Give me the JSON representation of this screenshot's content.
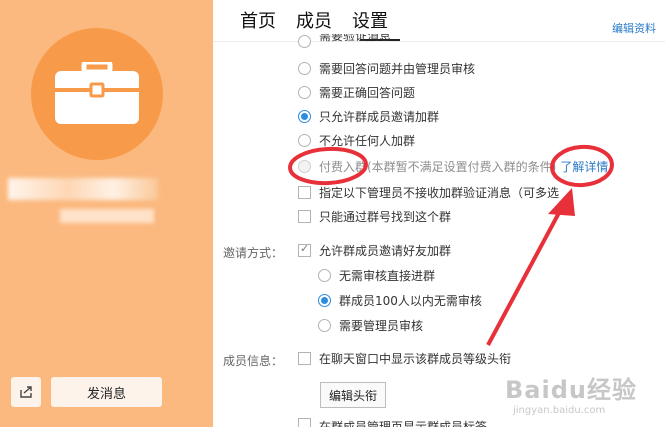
{
  "nav": {
    "tabs": [
      "首页",
      "成员",
      "设置"
    ],
    "active_tab": "设置",
    "edit_profile": "编辑资料"
  },
  "sidebar": {
    "send_message": "发消息",
    "share_icon": "share-icon",
    "avatar_icon": "briefcase-icon",
    "background_color": "#fbb97f",
    "avatar_color": "#f79a49"
  },
  "join_options": {
    "partial_top": "需要验证消息",
    "items": [
      {
        "label": "需要回答问题并由管理员审核",
        "selected": false
      },
      {
        "label": "需要正确回答问题",
        "selected": false
      },
      {
        "label": "只允许群成员邀请加群",
        "selected": true
      },
      {
        "label": "不允许任何人加群",
        "selected": false
      },
      {
        "label": "付费入群(本群暂不满足设置付费入群的条件)",
        "selected": false,
        "disabled": true,
        "link": "了解详情"
      }
    ],
    "checks": [
      {
        "label": "指定以下管理员不接收加群验证消息（可多选",
        "checked": false
      },
      {
        "label": "只能通过群号找到这个群",
        "checked": false
      }
    ]
  },
  "invite": {
    "label": "邀请方式：",
    "allow_invite": "允许群成员邀请好友加群",
    "allow_invite_checked": true,
    "options": [
      {
        "label": "无需审核直接进群",
        "selected": false
      },
      {
        "label": "群成员100人以内无需审核",
        "selected": true
      },
      {
        "label": "需要管理员审核",
        "selected": false
      }
    ]
  },
  "member_info": {
    "label": "成员信息：",
    "show_level": "在聊天窗口中显示该群成员等级头衔",
    "edit_title": "编辑头衔",
    "partial_bottom": "在群成员管理页显示群成员标签"
  },
  "annotation": {
    "color": "#e8303a"
  },
  "watermark": {
    "big": "Baidu经验",
    "small": "jingyan.baidu.com"
  }
}
